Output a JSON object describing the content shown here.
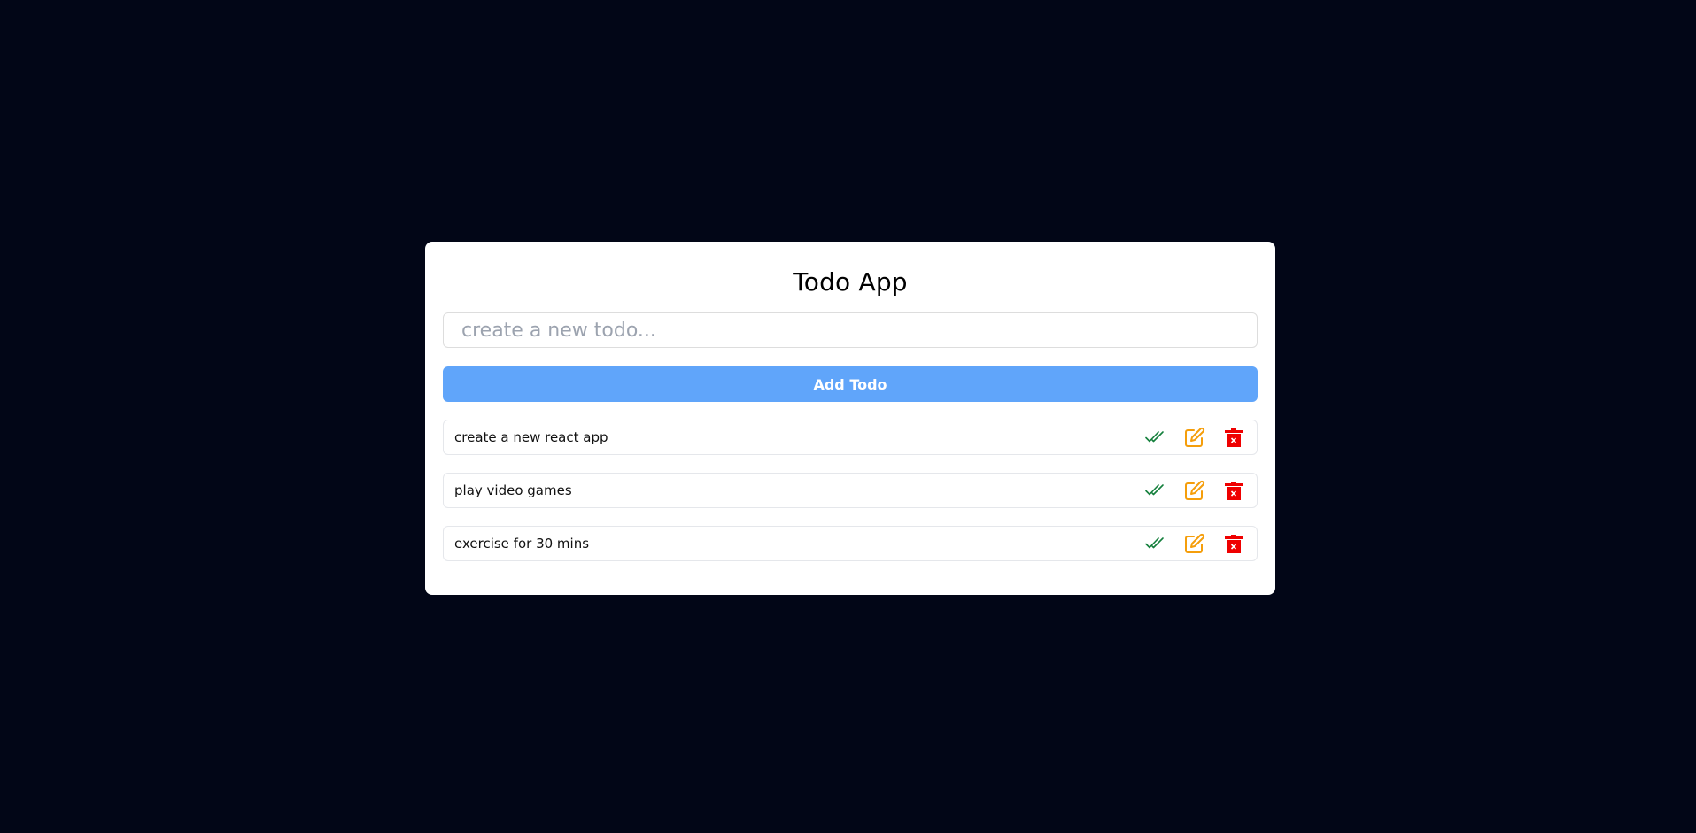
{
  "app": {
    "title": "Todo App"
  },
  "input": {
    "value": "",
    "placeholder": "create a new todo..."
  },
  "add_button": {
    "label": "Add Todo"
  },
  "todos": [
    {
      "text": "create a new react app"
    },
    {
      "text": "play video games"
    },
    {
      "text": "exercise for 30 mins"
    }
  ],
  "icons": {
    "complete": "double-check-icon",
    "edit": "edit-icon",
    "delete": "trash-icon"
  },
  "colors": {
    "background": "#020617",
    "card": "#ffffff",
    "accent": "#60a5fa",
    "complete": "#15803d",
    "edit": "#f59e0b",
    "delete": "#ef0000"
  }
}
